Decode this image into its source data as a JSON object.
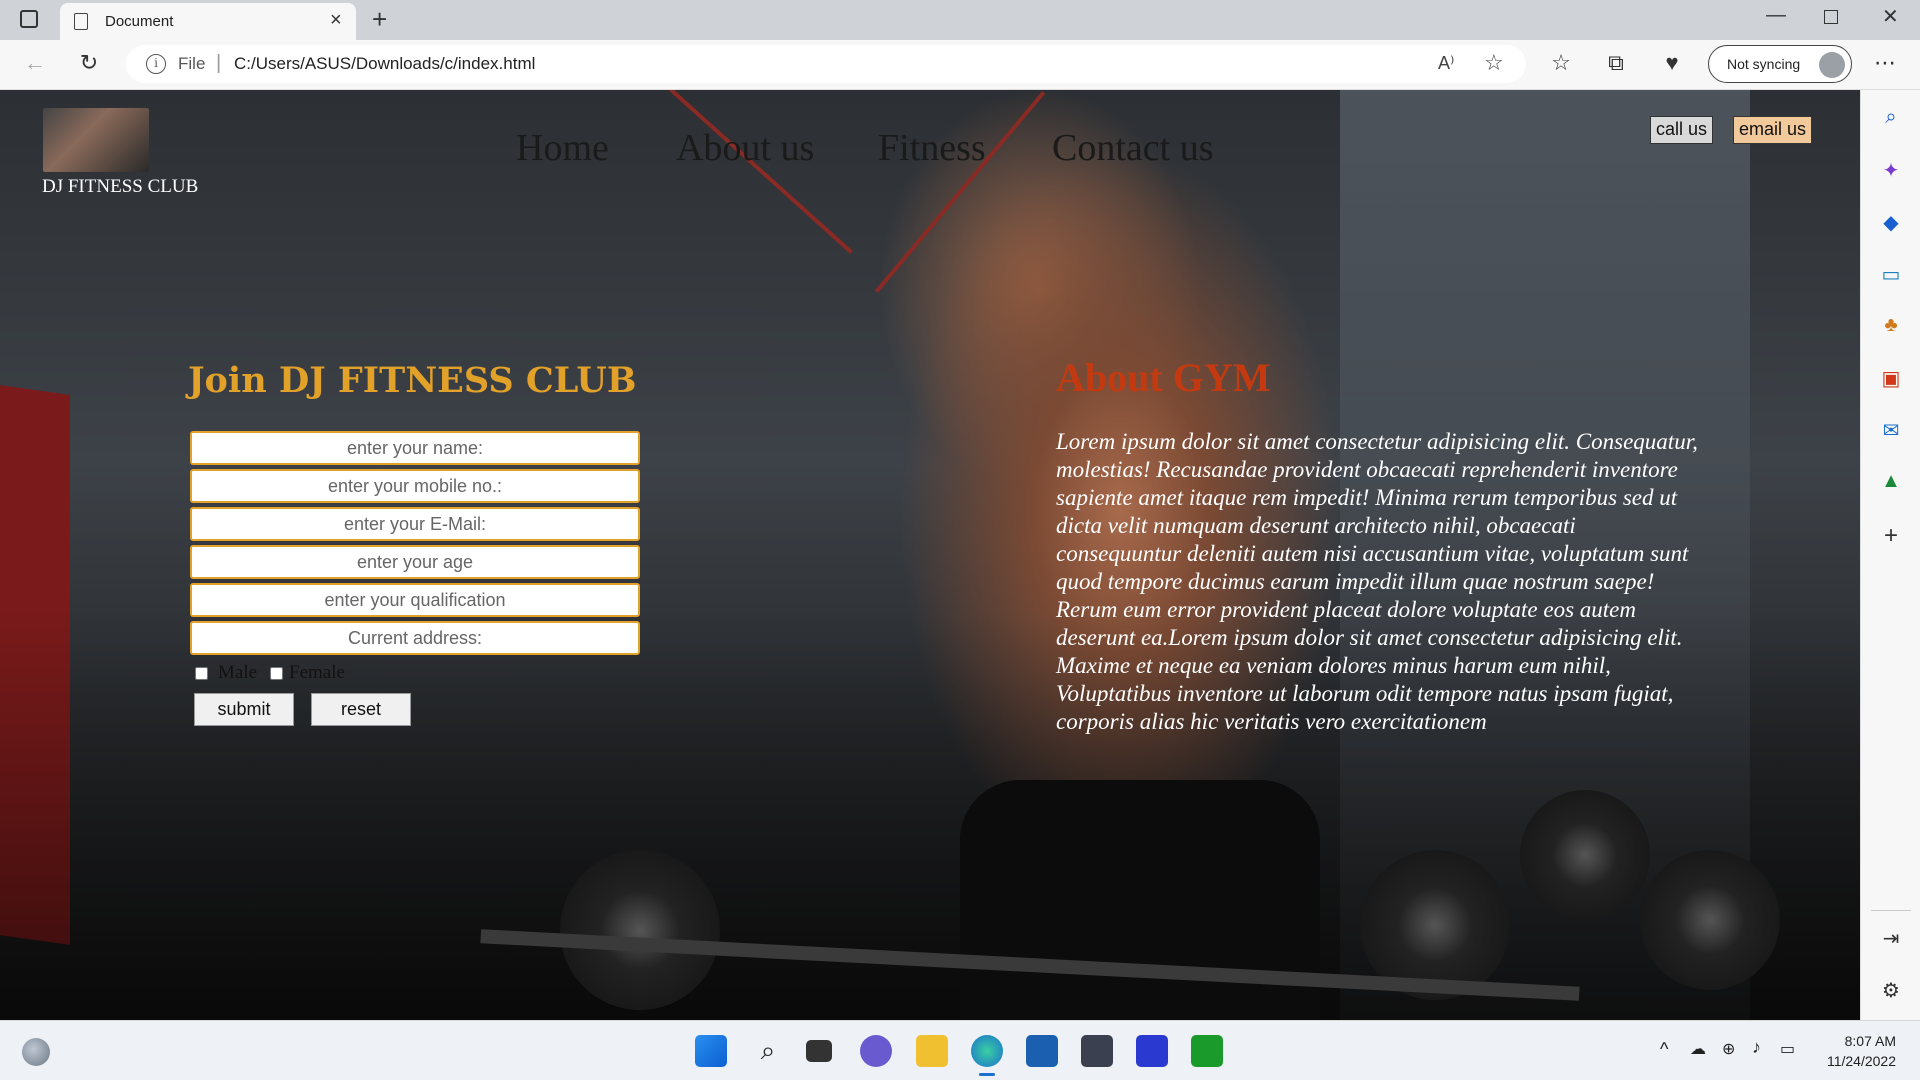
{
  "browser": {
    "tab_title": "Document",
    "scheme": "File",
    "url": "C:/Users/ASUS/Downloads/c/index.html",
    "sync_label": "Not syncing"
  },
  "site": {
    "brand": "DJ FITNESS CLUB",
    "nav": [
      "Home",
      "About us",
      "Fitness",
      "Contact us"
    ],
    "call_label": "call us",
    "email_label": "email us",
    "join_title": "Join DJ FITNESS CLUB",
    "fields": [
      "enter your name:",
      "enter your mobile no.:",
      "enter your E-Mail:",
      "enter your age",
      "enter your qualification",
      "Current address:"
    ],
    "gender": [
      "Male",
      "Female"
    ],
    "submit_label": "submit",
    "reset_label": "reset",
    "about_title": "About GYM",
    "about_text": "Lorem ipsum dolor sit amet consectetur adipisicing elit. Consequatur, molestias! Recusandae provident obcaecati reprehenderit inventore sapiente amet itaque rem impedit! Minima rerum temporibus sed ut dicta velit numquam deserunt architecto nihil, obcaecati consequuntur deleniti autem nisi accusantium vitae, voluptatum sunt quod tempore ducimus earum impedit illum quae nostrum saepe! Rerum eum error provident placeat dolore voluptate eos autem deserunt ea.Lorem ipsum dolor sit amet consectetur adipisicing elit. Maxime et neque ea veniam dolores minus harum eum nihil, Voluptatibus inventore ut laborum odit tempore natus ipsam fugiat, corporis alias hic veritatis vero exercitationem"
  },
  "taskbar": {
    "time": "8:07 AM",
    "date": "11/24/2022"
  },
  "colors": {
    "join_title": "#e2a22a",
    "about_title": "#c43a10",
    "email_button_bg": "#f2c99a",
    "call_button_bg": "#d9d9d9"
  }
}
